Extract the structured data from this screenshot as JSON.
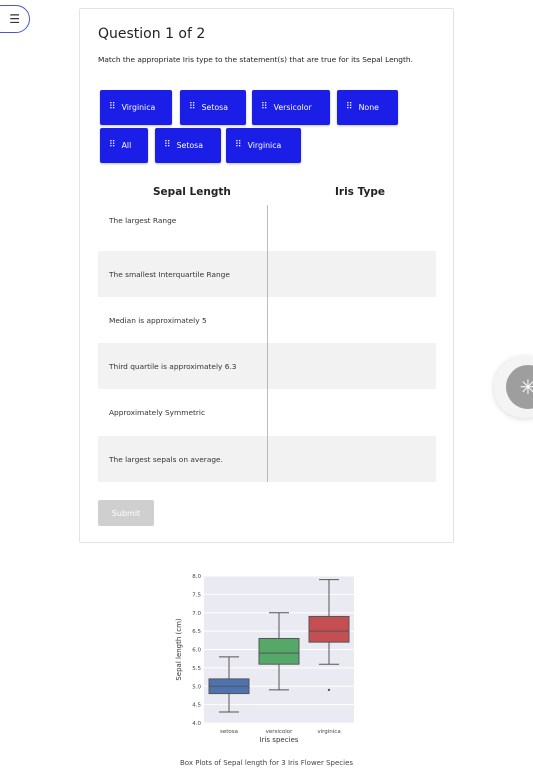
{
  "question": {
    "title": "Question 1 of 2",
    "instruction": "Match the appropriate Iris type to the statement(s) that are true for its Sepal Length."
  },
  "chips": [
    {
      "label": "Virginica"
    },
    {
      "label": "Setosa"
    },
    {
      "label": "Versicolor"
    },
    {
      "label": "None"
    },
    {
      "label": "All"
    },
    {
      "label": "Setosa"
    },
    {
      "label": "Virginica"
    }
  ],
  "table": {
    "col1_header": "Sepal Length",
    "col2_header": "Iris Type",
    "rows": [
      {
        "statement": "The largest Range"
      },
      {
        "statement": "The smallest Interquartile Range"
      },
      {
        "statement": "Median is approximately 5"
      },
      {
        "statement": "Third quartile is approximately 6.3"
      },
      {
        "statement": "Approximately Symmetric"
      },
      {
        "statement": "The largest sepals on average."
      }
    ]
  },
  "submit_label": "Submit",
  "icons": {
    "toc": "list-icon",
    "spinner": "loading-spinner-icon",
    "grip": "drag-handle-icon"
  },
  "colors": {
    "chip": "#1a1ee6",
    "setosa": "#4c72b0",
    "versicolor": "#55a868",
    "virginica": "#c44e52",
    "plot_bg": "#eaeaf2"
  },
  "chart_data": {
    "type": "box",
    "title": "",
    "xlabel": "Iris species",
    "ylabel": "Sepal length (cm)",
    "ylim": [
      4.0,
      8.0
    ],
    "yticks": [
      "4.0",
      "4.5",
      "5.0",
      "5.5",
      "6.0",
      "6.5",
      "7.0",
      "7.5",
      "8.0"
    ],
    "categories": [
      "setosa",
      "versicolor",
      "virginica"
    ],
    "boxes": [
      {
        "name": "setosa",
        "min": 4.3,
        "q1": 4.8,
        "median": 5.0,
        "q3": 5.2,
        "max": 5.8,
        "outliers": []
      },
      {
        "name": "versicolor",
        "min": 4.9,
        "q1": 5.6,
        "median": 5.9,
        "q3": 6.3,
        "max": 7.0,
        "outliers": []
      },
      {
        "name": "virginica",
        "min": 5.6,
        "q1": 6.2,
        "median": 6.5,
        "q3": 6.9,
        "max": 7.9,
        "outliers": [
          4.9
        ]
      }
    ],
    "grid": true
  },
  "caption": "Box Plots of Sepal length for 3 Iris Flower Species"
}
